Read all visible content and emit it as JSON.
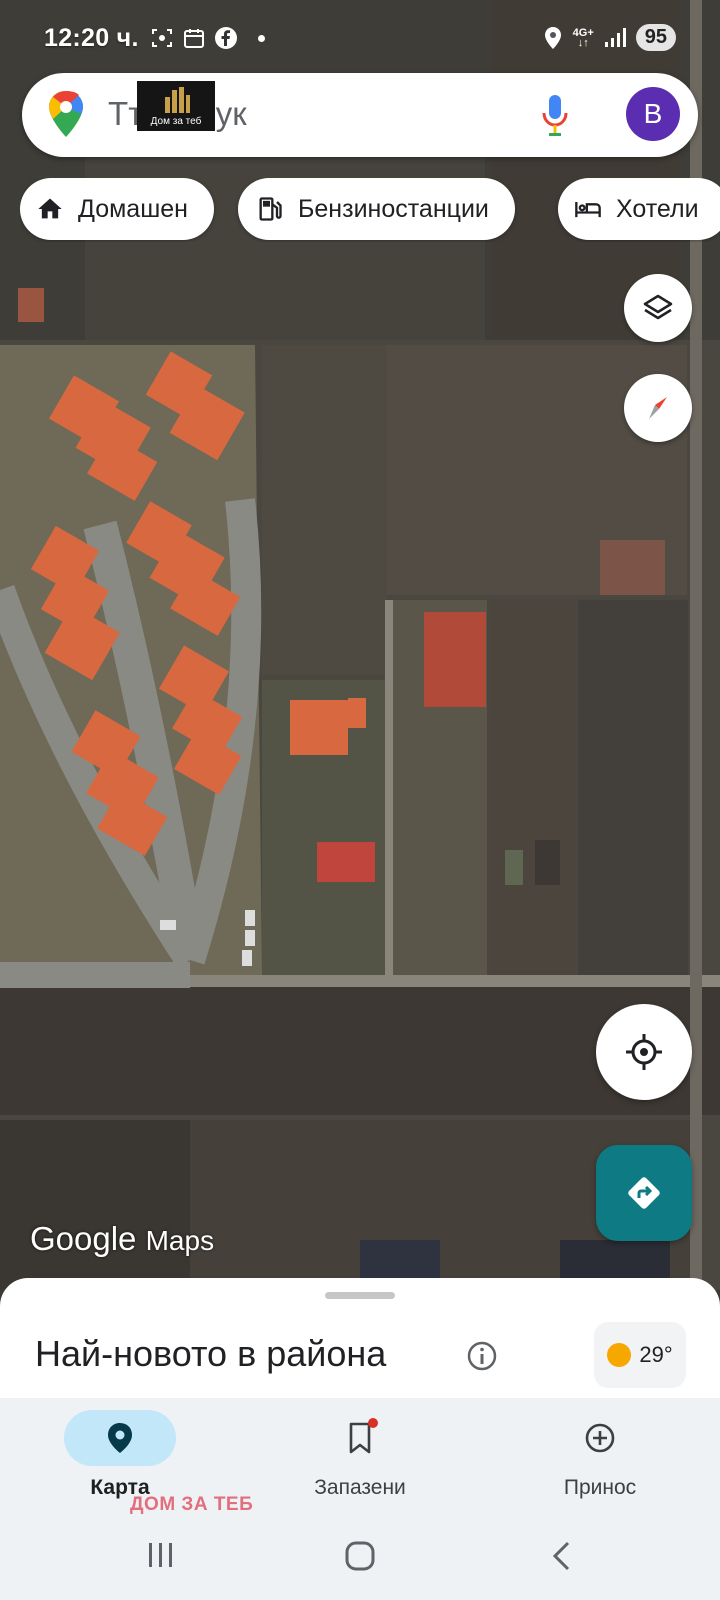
{
  "status_bar": {
    "time": "12:20 ч.",
    "network": "4G+",
    "battery": "95"
  },
  "search": {
    "placeholder": "Търсете тук",
    "visible_text": "Тъ        те тук",
    "watermark_caption": "Дом за теб",
    "avatar_letter": "B"
  },
  "chips": [
    {
      "icon": "home-icon",
      "label": "Домашен"
    },
    {
      "icon": "gas-station-icon",
      "label": "Бензиностанции"
    },
    {
      "icon": "hotel-bed-icon",
      "label": "Хотели"
    }
  ],
  "map": {
    "logo_google": "Google",
    "logo_maps": "Maps"
  },
  "sheet": {
    "title": "Най-новото в района",
    "weather_temp": "29°"
  },
  "nav": {
    "items": [
      {
        "label": "Карта",
        "icon": "map-pin-icon",
        "active": true
      },
      {
        "label": "Запазени",
        "icon": "bookmark-icon",
        "active": false
      },
      {
        "label": "Принос",
        "icon": "add-circle-icon",
        "active": false
      }
    ]
  },
  "watermark_text": "ДОМ ЗА ТЕБ",
  "colors": {
    "accent_teal": "#0e7b84",
    "avatar_purple": "#5b2db0",
    "active_pill": "#c2e7f8",
    "watermark_pink": "#e36f7c"
  }
}
